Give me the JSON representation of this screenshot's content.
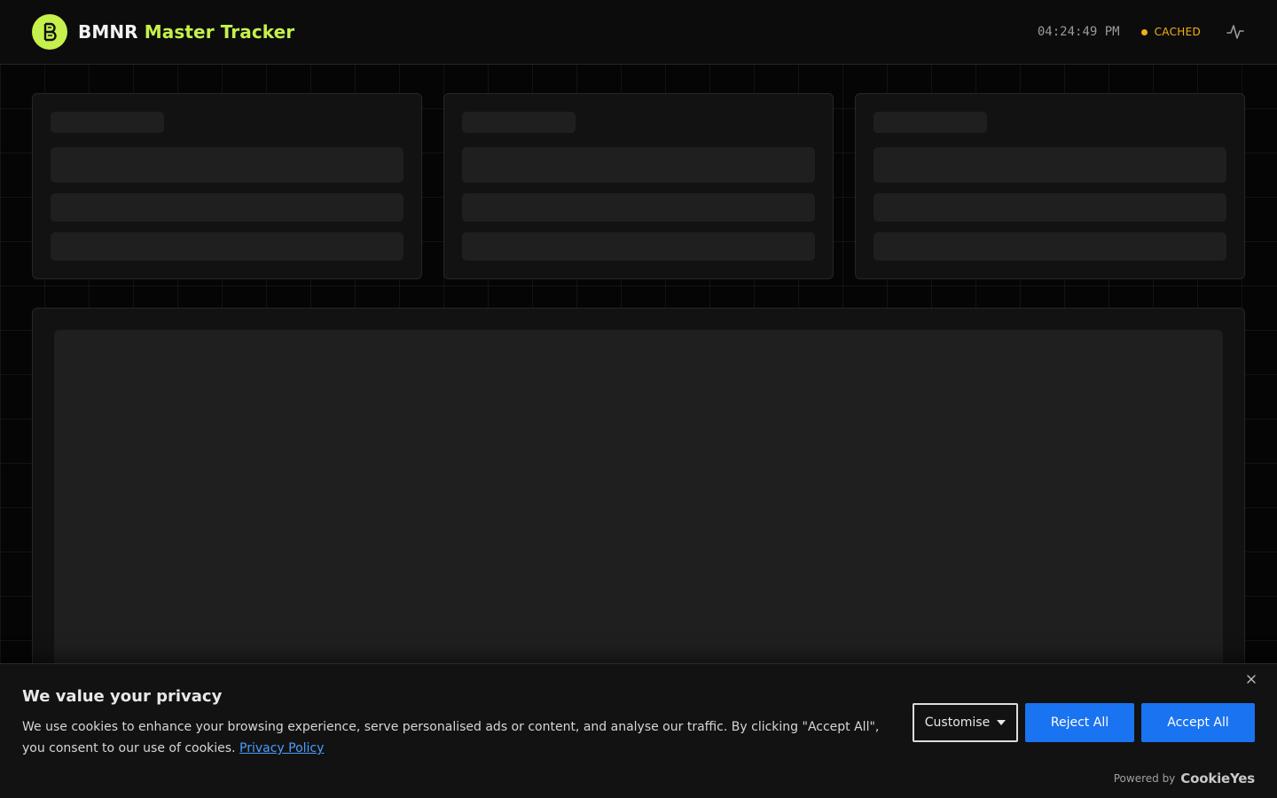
{
  "header": {
    "title_main": "BMNR",
    "title_accent": "Master Tracker",
    "clock": "04:24:49 PM",
    "status": "CACHED",
    "logo_icon": "b-logo-icon",
    "activity_icon": "activity-pulse-icon",
    "accent_color": "#c6f04c",
    "status_color": "#f5b014"
  },
  "cookie_banner": {
    "title": "We value your privacy",
    "text": "We use cookies to enhance your browsing experience, serve personalised ads or content, and analyse our traffic. By clicking \"Accept All\", you consent to our use of cookies.",
    "privacy_link": "Privacy Policy",
    "customise_label": "Customise",
    "reject_label": "Reject All",
    "accept_label": "Accept All",
    "powered_by": "Powered by",
    "powered_brand": "CookieYes",
    "button_color": "#1a73f0"
  }
}
